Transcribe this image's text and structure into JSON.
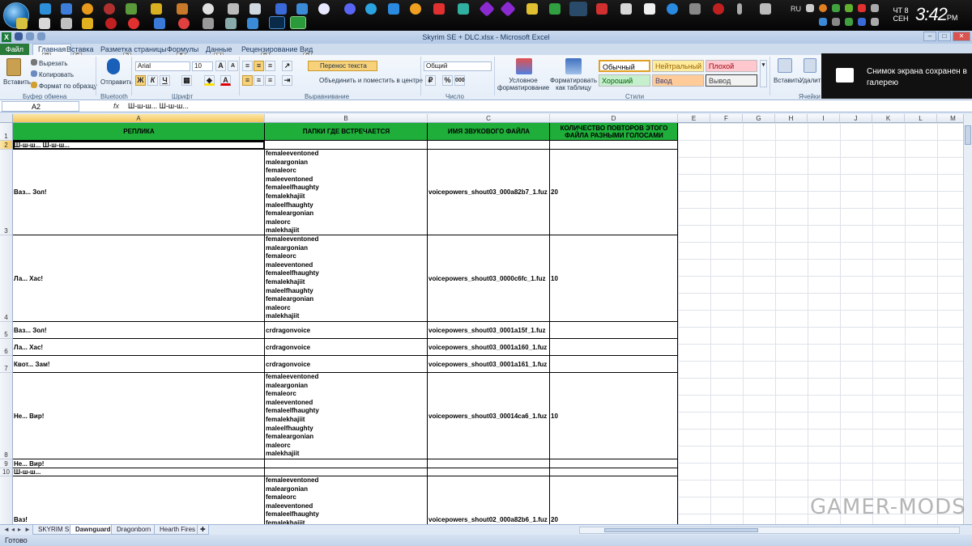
{
  "taskbar": {
    "language": "RU",
    "clock_day_line1": "ЧТ 8",
    "clock_day_line2": "СЕН",
    "clock_time": "3:42",
    "clock_ampm": "PM"
  },
  "window": {
    "title": "Skyrim SE + DLC.xlsx - Microsoft Excel"
  },
  "ribbon_tabs": {
    "file": "Файл",
    "home": "Главная",
    "insert": "Вставка",
    "page_layout": "Разметка страницы",
    "formulas": "Формулы",
    "data": "Данные",
    "review": "Рецензирование",
    "view": "Вид",
    "keytips": [
      "Я",
      "С",
      "З",
      "Л",
      "Ы",
      "Р",
      "О"
    ]
  },
  "ribbon": {
    "paste": "Вставить",
    "cut": "Вырезать",
    "copy": "Копировать",
    "format_painter": "Формат по образцу",
    "clipboard_group": "Буфер обмена",
    "send": "Отправить",
    "bluetooth_group": "Bluetooth",
    "font_name": "Arial",
    "font_size": "10",
    "bold": "Ж",
    "italic": "К",
    "underline": "Ч",
    "font_group": "Шрифт",
    "wrap_text": "Перенос текста",
    "merge_center": "Объединить и поместить в центре",
    "alignment_group": "Выравнивание",
    "number_format": "Общий",
    "number_group": "Число",
    "conditional_formatting_1": "Условное",
    "conditional_formatting_2": "форматирование",
    "format_as_table_1": "Форматировать",
    "format_as_table_2": "как таблицу",
    "styles": [
      "Обычный",
      "Нейтральный",
      "Плохой",
      "Хороший",
      "Ввод",
      "Вывод"
    ],
    "styles_group": "Стили",
    "insert_cells": "Вставить",
    "delete_cells": "Удалить",
    "cells_group": "Ячейки"
  },
  "toast": {
    "message": "Снимок экрана сохранен в галерею"
  },
  "formula_bar": {
    "name_box": "A2",
    "fx": "fx",
    "content": "Ш-ш-ш... Ш-ш-ш..."
  },
  "columns": [
    "A",
    "B",
    "C",
    "D",
    "E",
    "F",
    "G",
    "H",
    "I",
    "J",
    "K",
    "L",
    "M"
  ],
  "header_row": {
    "a": "РЕПЛИКА",
    "b": "ПАПКИ ГДЕ ВСТРЕЧАЕТСЯ",
    "c": "ИМЯ ЗВУКОВОГО ФАЙЛА",
    "d": "КОЛИЧЕСТВО ПОВТОРОВ ЭТОГО ФАЙЛА РАЗНЫМИ ГОЛОСАМИ"
  },
  "folders_common": [
    "femaleeventoned",
    "maleargonian",
    "femaleorc",
    "maleeventoned",
    "femaleelfhaughty",
    "femalekhajiit",
    "maleelfhaughty",
    "femaleargonian",
    "maleorc",
    "malekhajiit"
  ],
  "rows": [
    {
      "num": "1"
    },
    {
      "num": "2",
      "a": "Ш-ш-ш... Ш-ш-ш..."
    },
    {
      "num": "3",
      "a": "Ваз... Зол!",
      "c": "voicepowers_shout03_000a82b7_1.fuz",
      "d": "20"
    },
    {
      "num": "4",
      "a": "Ла... Хас!",
      "c": "voicepowers_shout03_0000c6fc_1.fuz",
      "d": "10"
    },
    {
      "num": "5",
      "a": "Ваз... Зол!",
      "b": "crdragonvoice",
      "c": "voicepowers_shout03_0001a15f_1.fuz"
    },
    {
      "num": "6",
      "a": "Ла... Хас!",
      "b": "crdragonvoice",
      "c": "voicepowers_shout03_0001a160_1.fuz"
    },
    {
      "num": "7",
      "a": "Квот... Зам!",
      "b": "crdragonvoice",
      "c": "voicepowers_shout03_0001a161_1.fuz"
    },
    {
      "num": "8",
      "a": "Не... Вир!",
      "c": "voicepowers_shout03_00014ca6_1.fuz",
      "d": "10"
    },
    {
      "num": "9",
      "a": "Не... Вир!"
    },
    {
      "num": "10",
      "a": "Ш-ш-ш..."
    },
    {
      "num": "11",
      "a": "Ваз!",
      "c": "voicepowers_shout02_000a82b6_1.fuz",
      "d": "20"
    }
  ],
  "folders_row11": [
    "femaleeventoned",
    "maleargonian",
    "femaleorc",
    "maleeventoned",
    "femaleelfhaughty",
    "femalekhajiit"
  ],
  "sheets": [
    "SKYRIM SE",
    "Dawnguard",
    "Dragonborn",
    "Hearth Fires"
  ],
  "status": {
    "ready": "Готово"
  },
  "watermark": "GAMER-MODS"
}
